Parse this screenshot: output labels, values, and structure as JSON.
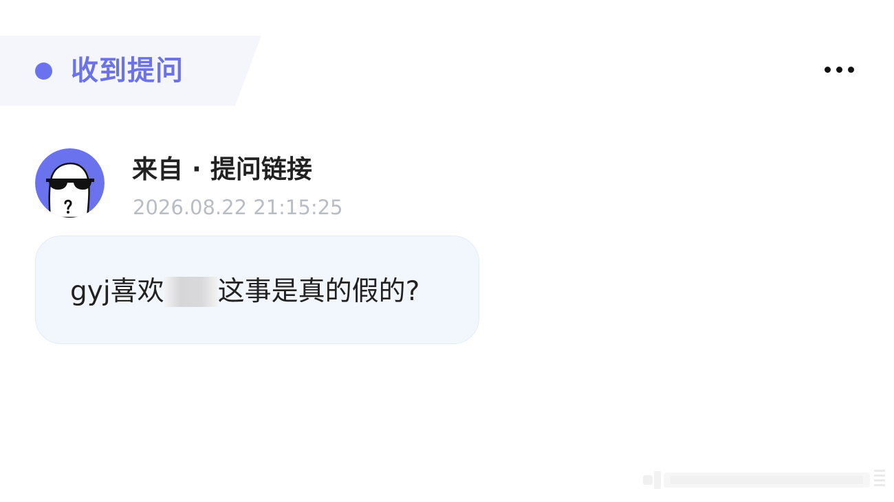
{
  "header": {
    "title": "收到提问"
  },
  "more_menu": {
    "icon": "more-horizontal-icon"
  },
  "sender": {
    "avatar_icon": "anonymous-sunglasses-avatar",
    "name": "来自 · 提问链接",
    "timestamp": "2026.08.22 21:15:25"
  },
  "question": {
    "text_before": "gyj喜欢",
    "text_after": "这事是真的假的?"
  },
  "colors": {
    "accent": "#6a72ee",
    "header_bg": "#f5f5fc",
    "bubble_bg": "#f2f7fd",
    "timestamp": "#b8bcc4"
  }
}
